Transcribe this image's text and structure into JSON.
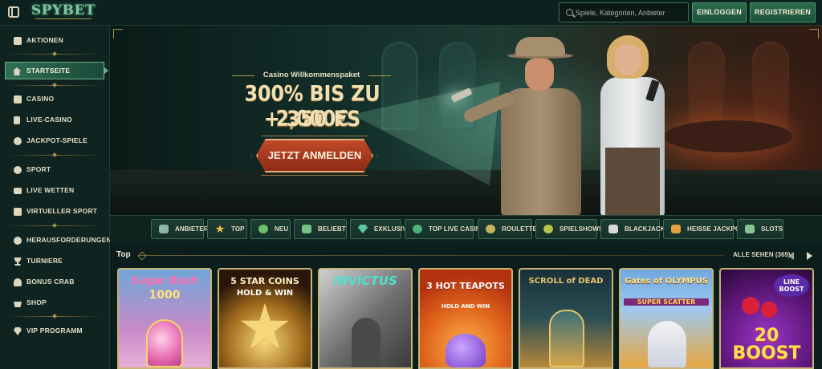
{
  "header": {
    "logo": "SPYBET",
    "search_placeholder": "Spiele, Kategorien, Anbieter",
    "login_label": "EINLOGGEN",
    "register_label": "REGISTRIEREN"
  },
  "sidebar": {
    "items": [
      {
        "label": "AKTIONEN",
        "icon": "gift-icon"
      },
      {
        "label": "STARTSEITE",
        "icon": "home-icon",
        "active": true
      },
      {
        "label": "CASINO",
        "icon": "slot-machine-icon"
      },
      {
        "label": "LIVE-CASINO",
        "icon": "playing-card-icon"
      },
      {
        "label": "JACKPOT-SPIELE",
        "icon": "clover-icon"
      },
      {
        "label": "SPORT",
        "icon": "ball-icon"
      },
      {
        "label": "LIVE WETTEN",
        "icon": "live-tv-icon"
      },
      {
        "label": "VIRTUELLER SPORT",
        "icon": "virtual-screen-icon"
      },
      {
        "label": "HERAUSFORDERUNGEN",
        "icon": "medal-icon"
      },
      {
        "label": "TURNIERE",
        "icon": "trophy-icon"
      },
      {
        "label": "BONUS CRAB",
        "icon": "crab-icon"
      },
      {
        "label": "SHOP",
        "icon": "basket-icon"
      },
      {
        "label": "VIP PROGRAMM",
        "icon": "diamond-icon"
      }
    ]
  },
  "hero": {
    "subtitle": "Casino Willkommenspaket",
    "title_line1": "300% BIS ZU 2,000€",
    "title_line2": "+ 350 FS",
    "cta_label": "JETZT ANMELDEN"
  },
  "categories": [
    {
      "label": "ANBIETER",
      "icon": "provider-icon",
      "color": "#8fb3a6"
    },
    {
      "label": "TOP",
      "icon": "star-icon",
      "color": "#e9c24a"
    },
    {
      "label": "NEU",
      "icon": "new-badge-icon",
      "color": "#6fc06a"
    },
    {
      "label": "BELIEBT",
      "icon": "flame-icon",
      "color": "#74c485"
    },
    {
      "label": "EXKLUSIV",
      "icon": "gem-icon",
      "color": "#5fc7a0"
    },
    {
      "label": "TOP LIVE CASINO",
      "icon": "chip-icon",
      "color": "#4fb07a"
    },
    {
      "label": "ROULETTE",
      "icon": "roulette-icon",
      "color": "#c9b25a"
    },
    {
      "label": "SPIELSHOWS",
      "icon": "wheel-icon",
      "color": "#b7c24a"
    },
    {
      "label": "BLACKJACK",
      "icon": "cards-icon",
      "color": "#d9d9d9"
    },
    {
      "label": "HEISSE JACKPOTS",
      "icon": "fire-jackpot-icon",
      "color": "#e0a23e"
    },
    {
      "label": "SLOTS",
      "icon": "slots-icon",
      "color": "#8ac38f"
    }
  ],
  "top_section": {
    "title": "Top",
    "see_all": "ALLE SEHEN (369)"
  },
  "games": [
    {
      "title": "Sugar Rush",
      "subtitle": "1000",
      "title_color": "#ff6fb3",
      "sub_color": "#ffe27a"
    },
    {
      "title": "5 STAR COINS",
      "subtitle": "HOLD & WIN",
      "title_color": "#fff1c2",
      "sub_color": "#ffffff"
    },
    {
      "title": "INVICTUS",
      "subtitle": "",
      "title_color": "#4fe0d2",
      "sub_color": "#ffffff"
    },
    {
      "title": "3 HOT TEAPOTS",
      "subtitle": "HOLD AND WIN",
      "title_color": "#ffffff",
      "sub_color": "#ffffff"
    },
    {
      "title": "SCROLL of DEAD",
      "subtitle": "",
      "title_color": "#e8c26a",
      "sub_color": "#ffffff"
    },
    {
      "title": "Gates of OLYMPUS",
      "subtitle": "SUPER SCATTER",
      "title_color": "#ffe58a",
      "sub_color": "#ffd24a"
    },
    {
      "title": "LINE BOOST",
      "subtitle": "20 BOOST",
      "title_color": "#ffffff",
      "sub_color": "#ffe14f"
    }
  ]
}
